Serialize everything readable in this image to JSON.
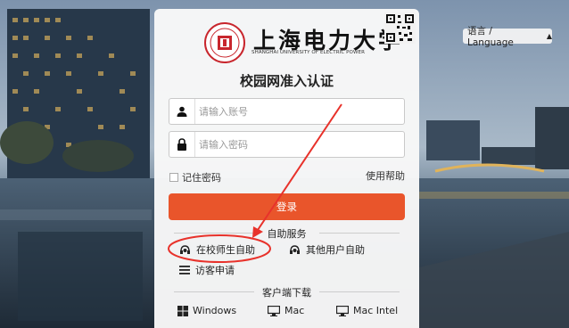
{
  "language": {
    "label": "语言 / Language",
    "icon": "chevron-down-icon"
  },
  "brand": {
    "name": "上海电力大学",
    "subtitle": "SHANGHAI UNIVERSITY OF ELECTRIC POWER",
    "logo_icon": "university-seal-logo",
    "qr_icon": "qr-code-icon"
  },
  "title": "校园网准入认证",
  "form": {
    "username_placeholder": "请输入账号",
    "password_placeholder": "请输入密码",
    "remember_label": "记住密码",
    "help_label": "使用帮助",
    "login_label": "登录"
  },
  "self_service": {
    "heading": "自助服务",
    "items": [
      {
        "label": "在校师生自助",
        "icon": "user-headset-icon"
      },
      {
        "label": "其他用户自助",
        "icon": "user-headset-icon"
      },
      {
        "label": "访客申请",
        "icon": "list-icon"
      }
    ]
  },
  "downloads": {
    "heading": "客户端下载",
    "items": [
      {
        "label": "Windows",
        "icon": "windows-icon"
      },
      {
        "label": "Mac",
        "icon": "monitor-icon"
      },
      {
        "label": "Mac Intel",
        "icon": "monitor-icon"
      }
    ]
  },
  "colors": {
    "accent": "#e9552b",
    "annotation": "#e8322b"
  }
}
